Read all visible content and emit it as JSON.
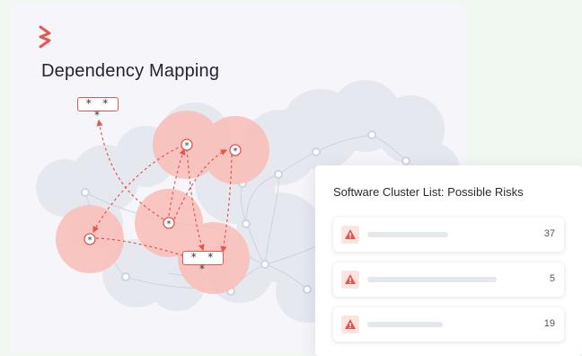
{
  "title": "Dependency Mapping",
  "node_mask": "* * *",
  "node_symbol": "*",
  "colors": {
    "accent": "#e3574f",
    "halo": "#f9b9b3"
  },
  "panel": {
    "title": "Software Cluster List: Possible Risks",
    "rows": [
      {
        "count": "37",
        "bar_fraction": 0.45
      },
      {
        "count": "5",
        "bar_fraction": 0.72
      },
      {
        "count": "19",
        "bar_fraction": 0.42
      }
    ]
  }
}
